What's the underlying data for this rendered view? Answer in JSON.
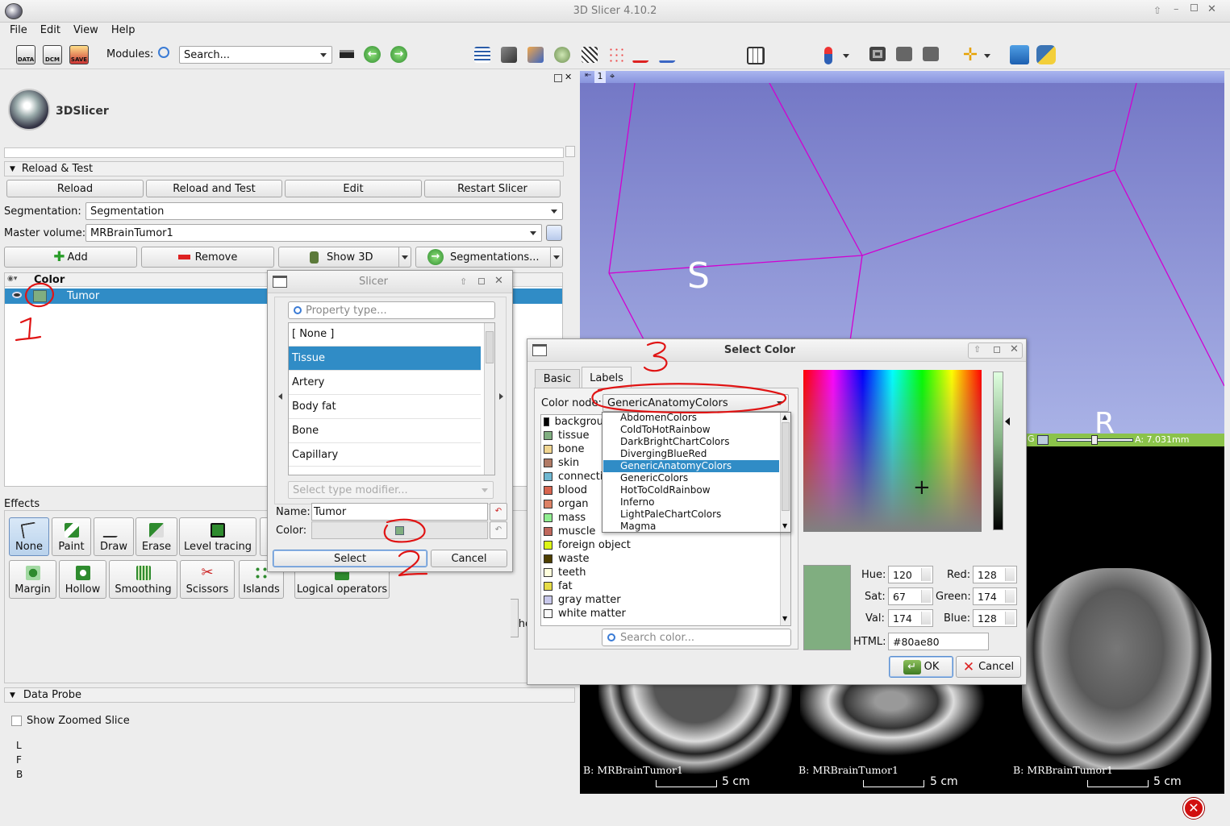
{
  "app": {
    "title": "3D Slicer 4.10.2",
    "menu": [
      "File",
      "Edit",
      "View",
      "Help"
    ],
    "modules_label": "Modules:",
    "search_placeholder": "Search...",
    "logo_text": "3DSlicer"
  },
  "reload": {
    "section_label": "Reload & Test",
    "buttons": [
      "Reload",
      "Reload and Test",
      "Edit",
      "Restart Slicer"
    ]
  },
  "segment_editor": {
    "segmentation_label": "Segmentation:",
    "segmentation_value": "Segmentation",
    "master_label": "Master volume:",
    "master_value": "MRBrainTumor1",
    "add_label": "Add",
    "remove_label": "Remove",
    "show3d_label": "Show 3D",
    "segmentations_label": "Segmentations...",
    "table_header": "Color",
    "segment_name": "Tumor",
    "segment_color": "#80ae80"
  },
  "effects": {
    "label": "Effects",
    "row1": [
      "None",
      "Paint",
      "Draw",
      "Erase",
      "Level tracing"
    ],
    "row2": [
      "Margin",
      "Hollow",
      "Smoothing",
      "Scissors",
      "Islands",
      "Logical operators"
    ],
    "partial": "sho"
  },
  "data_probe": {
    "label": "Data Probe",
    "checkbox": "Show Zoomed Slice",
    "coords": [
      "L",
      "F",
      "B"
    ]
  },
  "slicer_dialog": {
    "title": "Slicer",
    "property_placeholder": "Property type...",
    "items": [
      "[ None ]",
      "Tissue",
      "Artery",
      "Body fat",
      "Bone",
      "Capillary"
    ],
    "selected_item": "Tissue",
    "modifier_placeholder": "Select type modifier...",
    "name_label": "Name:",
    "name_value": "Tumor",
    "color_label": "Color:",
    "select_label": "Select",
    "cancel_label": "Cancel"
  },
  "select_color": {
    "title": "Select Color",
    "tabs": [
      "Basic",
      "Labels"
    ],
    "active_tab": "Labels",
    "color_node_label": "Color node:",
    "color_node_value": "GenericAnatomyColors",
    "dropdown_items": [
      "AbdomenColors",
      "ColdToHotRainbow",
      "DarkBrightChartColors",
      "DivergingBlueRed",
      "GenericAnatomyColors",
      "GenericColors",
      "HotToColdRainbow",
      "Inferno",
      "LightPaleChartColors",
      "Magma"
    ],
    "dropdown_selected": "GenericAnatomyColors",
    "color_list": [
      {
        "name": "backgrou",
        "color": "#000000"
      },
      {
        "name": "tissue",
        "color": "#80ae80"
      },
      {
        "name": "bone",
        "color": "#f1d691"
      },
      {
        "name": "skin",
        "color": "#b17a65"
      },
      {
        "name": "connecti",
        "color": "#6fb8d2"
      },
      {
        "name": "blood",
        "color": "#d8654f"
      },
      {
        "name": "organ",
        "color": "#dd8265"
      },
      {
        "name": "mass",
        "color": "#90ee90"
      },
      {
        "name": "muscle",
        "color": "#c0685c"
      },
      {
        "name": "foreign object",
        "color": "#dcf514"
      },
      {
        "name": "waste",
        "color": "#4e3f00"
      },
      {
        "name": "teeth",
        "color": "#ffffdc"
      },
      {
        "name": "fat",
        "color": "#e6dc46"
      },
      {
        "name": "gray matter",
        "color": "#c8c8eb"
      },
      {
        "name": "white matter",
        "color": "#fafafa"
      }
    ],
    "search_placeholder": "Search color...",
    "hue_label": "Hue:",
    "hue": "120",
    "sat_label": "Sat:",
    "sat": "67",
    "val_label": "Val:",
    "val": "174",
    "red_label": "Red:",
    "red": "128",
    "green_label": "Green:",
    "green": "174",
    "blue_label": "Blue:",
    "blue": "128",
    "html_label": "HTML:",
    "html": "#80ae80",
    "ok_label": "OK",
    "cancel_label": "Cancel"
  },
  "views": {
    "view3d_number": "1",
    "orient_s": "S",
    "orient_r": "R",
    "slice_label": "A: 7.031mm",
    "slice_letter": "G",
    "slice_volume": "B: MRBrainTumor1",
    "scale": "5 cm"
  },
  "annotations": [
    "1",
    "2",
    "3"
  ],
  "colors": {
    "accent": "#308cc6",
    "view3d_top": "#7478c6",
    "view3d_bottom": "#a9b2e6",
    "slice_bar": "#8bc34a",
    "annotation": "#e01414"
  }
}
